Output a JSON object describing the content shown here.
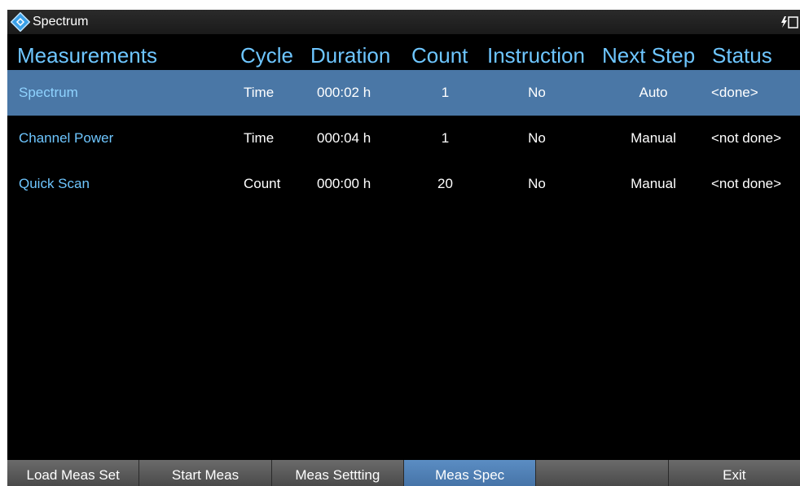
{
  "titlebar": {
    "title": "Spectrum",
    "logo_icon": "rohde-schwarz-logo-icon",
    "power_icon": "battery-charging-icon"
  },
  "header": {
    "measurements": "Measurements",
    "cycle": "Cycle",
    "duration": "Duration",
    "count": "Count",
    "instruction": "Instruction",
    "next_step": "Next Step",
    "status": "Status"
  },
  "rows": [
    {
      "name": "Spectrum",
      "cycle": "Time",
      "duration": "000:02 h",
      "count": "1",
      "instruction": "No",
      "next_step": "Auto",
      "status": "<done>",
      "selected": true
    },
    {
      "name": "Channel Power",
      "cycle": "Time",
      "duration": "000:04 h",
      "count": "1",
      "instruction": "No",
      "next_step": "Manual",
      "status": "<not done>",
      "selected": false
    },
    {
      "name": "Quick Scan",
      "cycle": "Count",
      "duration": "000:00 h",
      "count": "20",
      "instruction": "No",
      "next_step": "Manual",
      "status": "<not done>",
      "selected": false
    }
  ],
  "softkeys": [
    "Load Meas Set",
    "Start Meas",
    "Meas Settting",
    "Meas Spec",
    "",
    "Exit"
  ],
  "active_softkey": "Meas Spec",
  "colors": {
    "accent": "#6ec6ff",
    "selected_row": "#4a77a6",
    "active_softkey": "#5b8dc3"
  }
}
